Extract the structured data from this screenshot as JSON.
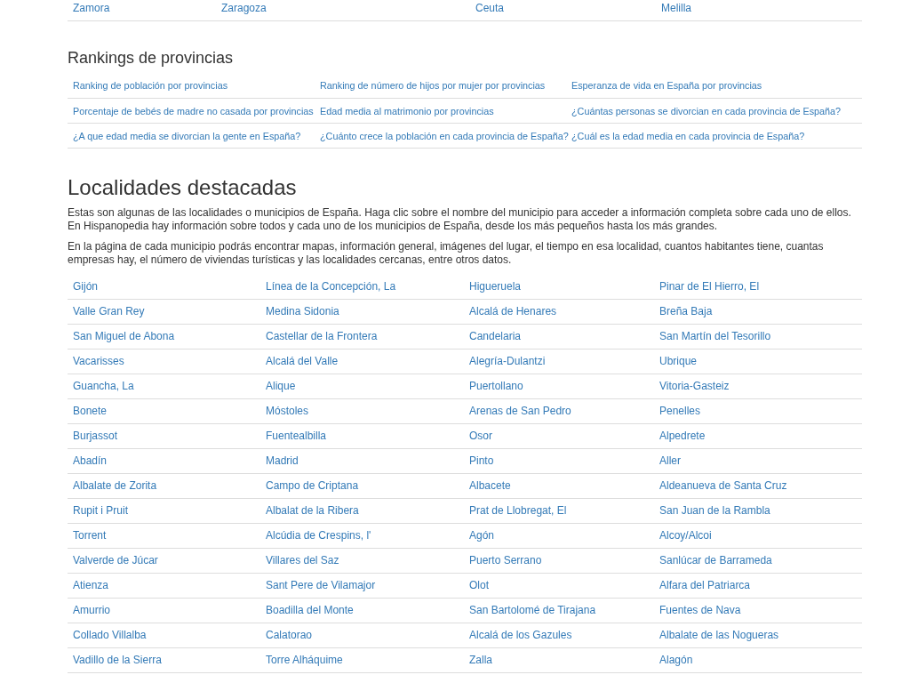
{
  "provinces_table": {
    "rows": [
      [
        "Zamora",
        "Zaragoza",
        "Ceuta",
        "Melilla"
      ]
    ]
  },
  "rankings": {
    "title": "Rankings de provincias",
    "rows": [
      [
        "Ranking de población por provincias",
        "Ranking de número de hijos por mujer por provincias",
        "Esperanza de vida en España por provincias"
      ],
      [
        "Porcentaje de bebés de madre no casada por provincias",
        "Edad media al matrimonio por provincias",
        "¿Cuántas personas se divorcian en cada provincia de España?"
      ],
      [
        "¿A que edad media se divorcian la gente en España?",
        "¿Cuánto crece la población en cada provincia de España?",
        "¿Cuál es la edad media en cada provincia de España?"
      ]
    ]
  },
  "featured": {
    "title": "Localidades destacadas",
    "paragraphs": [
      "Estas son algunas de las localidades o municipios de España. Haga clic sobre el nombre del municipio para acceder a información completa sobre cada uno de ellos. En Hispanopedia hay información sobre todos y cada uno de los municipios de España, desde los más pequeños hasta los más grandes.",
      "En la página de cada municipio podrás encontrar mapas, información general, imágenes del lugar, el tiempo en esa localidad, cuantos habitantes tiene, cuantas empresas hay, el número de viviendas turísticas y las localidades cercanas, entre otros datos."
    ],
    "rows": [
      [
        "Gijón",
        "Línea de la Concepción, La",
        "Higueruela",
        "Pinar de El Hierro, El"
      ],
      [
        "Valle Gran Rey",
        "Medina Sidonia",
        "Alcalá de Henares",
        "Breña Baja"
      ],
      [
        "San Miguel de Abona",
        "Castellar de la Frontera",
        "Candelaria",
        "San Martín del Tesorillo"
      ],
      [
        "Vacarisses",
        "Alcalá del Valle",
        "Alegría-Dulantzi",
        "Ubrique"
      ],
      [
        "Guancha, La",
        "Alique",
        "Puertollano",
        "Vitoria-Gasteiz"
      ],
      [
        "Bonete",
        "Móstoles",
        "Arenas de San Pedro",
        "Penelles"
      ],
      [
        "Burjassot",
        "Fuentealbilla",
        "Osor",
        "Alpedrete"
      ],
      [
        "Abadín",
        "Madrid",
        "Pinto",
        "Aller"
      ],
      [
        "Albalate de Zorita",
        "Campo de Criptana",
        "Albacete",
        "Aldeanueva de Santa Cruz"
      ],
      [
        "Rupit i Pruit",
        "Albalat de la Ribera",
        "Prat de Llobregat, El",
        "San Juan de la Rambla"
      ],
      [
        "Torrent",
        "Alcúdia de Crespins, l'",
        "Agón",
        "Alcoy/Alcoi"
      ],
      [
        "Valverde de Júcar",
        "Villares del Saz",
        "Puerto Serrano",
        "Sanlúcar de Barrameda"
      ],
      [
        "Atienza",
        "Sant Pere de Vilamajor",
        "Olot",
        "Alfara del Patriarca"
      ],
      [
        "Amurrio",
        "Boadilla del Monte",
        "San Bartolomé de Tirajana",
        "Fuentes de Nava"
      ],
      [
        "Collado Villalba",
        "Calatorao",
        "Alcalá de los Gazules",
        "Albalate de las Nogueras"
      ],
      [
        "Vadillo de la Sierra",
        "Torre Alháquime",
        "Zalla",
        "Alagón"
      ]
    ]
  }
}
